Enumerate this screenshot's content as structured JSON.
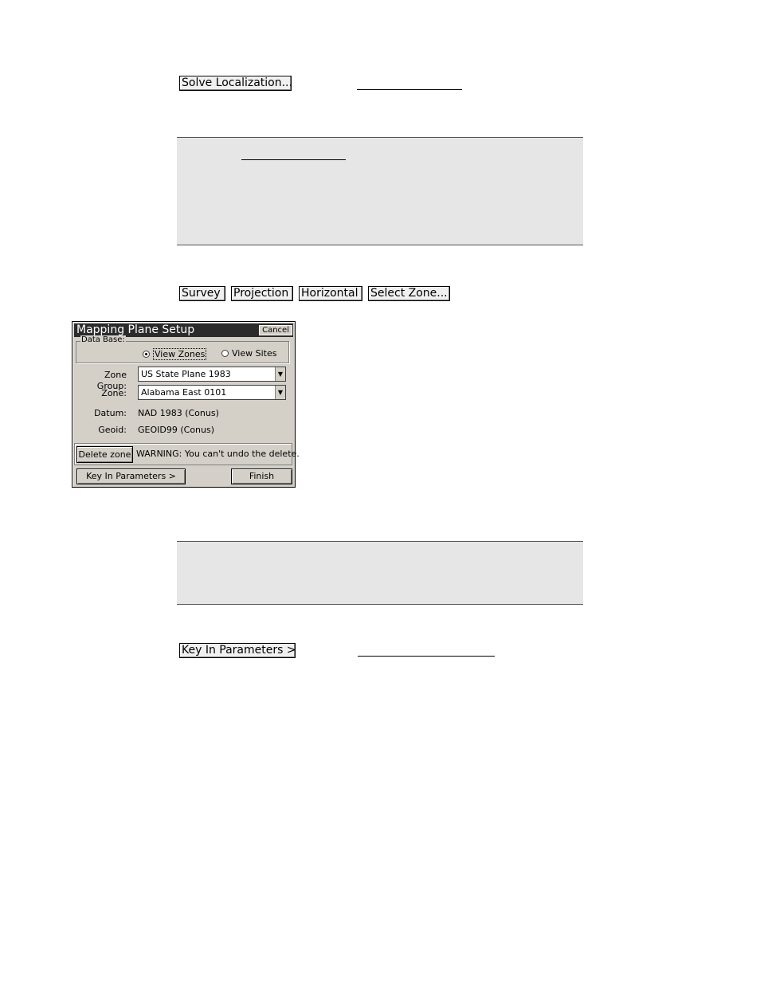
{
  "solve_localization_button": "Solve Localization...",
  "path_buttons": [
    "Survey",
    "Projection",
    "Horizontal",
    "Select Zone..."
  ],
  "dialog": {
    "title": "Mapping Plane Setup",
    "cancel_label": "Cancel",
    "data_base": {
      "legend": "Data Base:",
      "options": [
        {
          "label": "View Zones",
          "selected": true
        },
        {
          "label": "View Sites",
          "selected": false
        }
      ]
    },
    "zone_group": {
      "label": "Zone Group:",
      "value": "US State Plane 1983"
    },
    "zone": {
      "label": "Zone:",
      "value": "Alabama East 0101"
    },
    "datum": {
      "label": "Datum:",
      "value": "NAD 1983 (Conus)"
    },
    "geoid": {
      "label": "Geoid:",
      "value": "GEOID99 (Conus)"
    },
    "delete_zone_label": "Delete zone",
    "warning": "WARNING: You can't undo the delete.",
    "key_in_label": "Key In Parameters >",
    "finish_label": "Finish"
  },
  "key_in_parameters_button": "Key In Parameters >"
}
